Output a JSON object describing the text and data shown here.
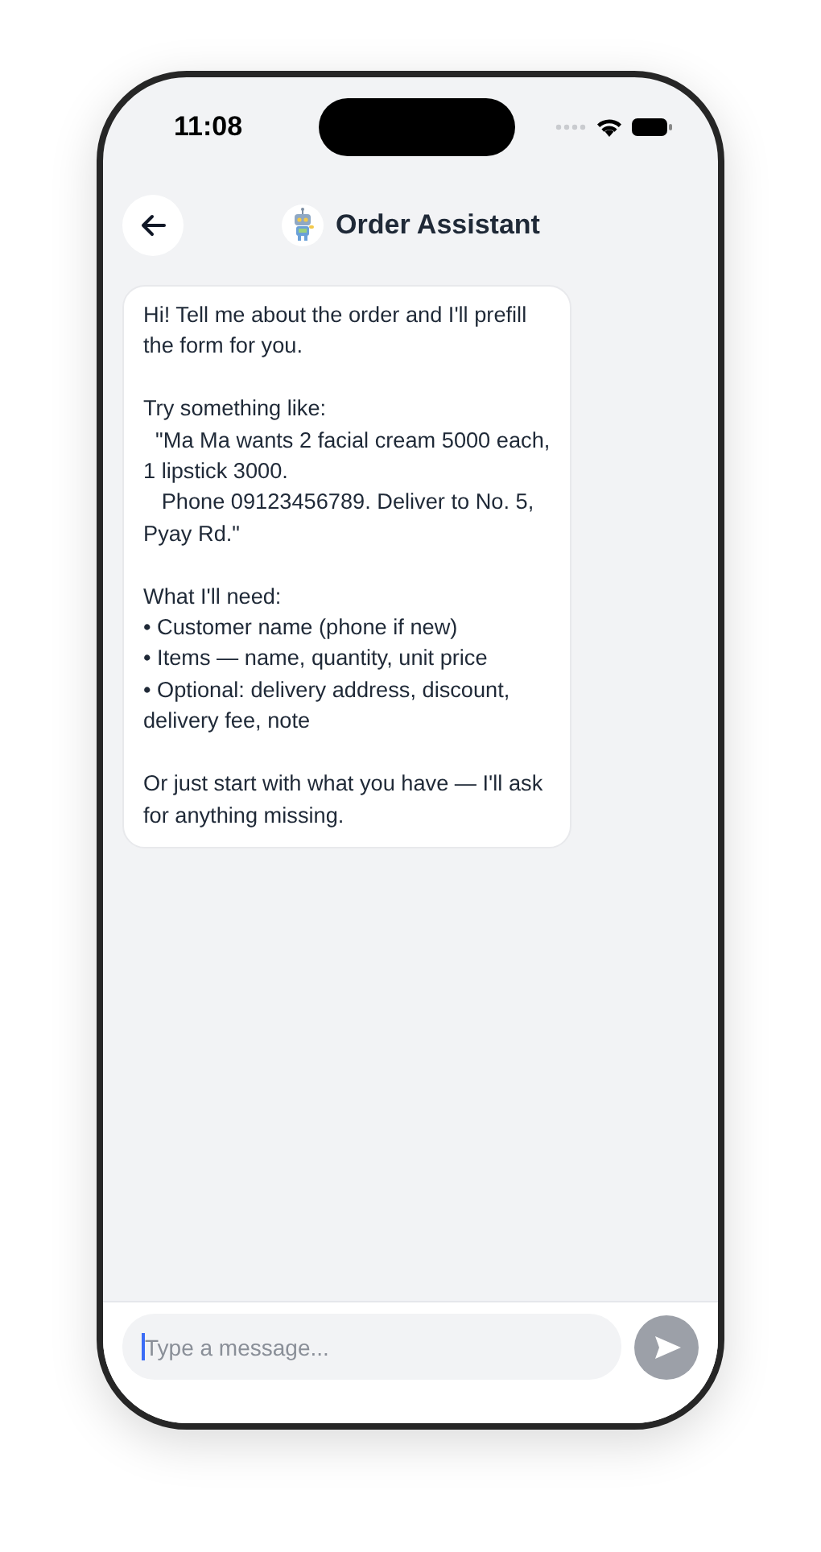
{
  "status_bar": {
    "time": "11:08"
  },
  "header": {
    "title": "Order Assistant"
  },
  "messages": [
    {
      "kind": "incoming",
      "text": "Hi! Tell me about the order and I'll prefill\nthe form for you.\n\nTry something like:\n  \"Ma Ma wants 2 facial cream 5000 each,\n1 lipstick 3000.\n   Phone 09123456789. Deliver to No. 5,\nPyay Rd.\"\n\nWhat I'll need:\n• Customer name (phone if new)\n• Items — name, quantity, unit price\n• Optional: delivery address, discount,\ndelivery fee, note\n\nOr just start with what you have — I'll ask\nfor anything missing."
    }
  ],
  "composer": {
    "placeholder": "Type a message...",
    "send_disabled": true
  }
}
